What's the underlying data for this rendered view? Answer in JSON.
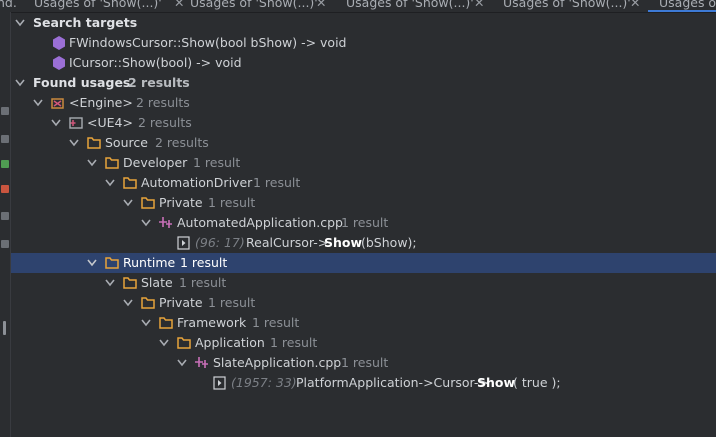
{
  "tabs": [
    {
      "label": "nd."
    },
    {
      "label": "Usages of 'Show(...)'"
    },
    {
      "label": "Usages of 'Show(...)'"
    },
    {
      "label": "Usages of 'Show(...)'"
    },
    {
      "label": "Usages of 'Show(...)'"
    },
    {
      "label": "Usages of"
    }
  ],
  "search_targets": {
    "label": "Search targets",
    "items": [
      "FWindowsCursor::Show(bool bShow) -> void",
      "ICursor::Show(bool) -> void"
    ]
  },
  "found_usages": {
    "label": "Found usages",
    "count": "2 results",
    "engine": {
      "name": "<Engine>",
      "count": "2 results"
    },
    "ue4": {
      "name": "<UE4>",
      "count": "2 results"
    },
    "source": {
      "name": "Source",
      "count": "2 results"
    },
    "developer": {
      "name": "Developer",
      "count": "1 result"
    },
    "automation_driver": {
      "name": "AutomationDriver",
      "count": "1 result"
    },
    "private1": {
      "name": "Private",
      "count": "1 result"
    },
    "automated_app_cpp": {
      "name": "AutomatedApplication.cpp",
      "count": "1 result"
    },
    "usage1": {
      "loc": "(96: 17)",
      "pre": "RealCursor->",
      "kw": "Show",
      "post": "(bShow);"
    },
    "runtime": {
      "name": "Runtime",
      "count": "1 result"
    },
    "slate": {
      "name": "Slate",
      "count": "1 result"
    },
    "private2": {
      "name": "Private",
      "count": "1 result"
    },
    "framework": {
      "name": "Framework",
      "count": "1 result"
    },
    "application": {
      "name": "Application",
      "count": "1 result"
    },
    "slate_app_cpp": {
      "name": "SlateApplication.cpp",
      "count": "1 result"
    },
    "usage2": {
      "loc": "(1957: 33)",
      "pre": "PlatformApplication->Cursor->",
      "kw": "Show",
      "post": "( true );"
    }
  },
  "colors": {
    "background": "#2b2d30",
    "selection": "#2e436e",
    "folder": "#e8a33a",
    "method_icon": "#9b6fd6",
    "cpp_icon": "#c86fb7",
    "accent": "#3d7ad6"
  }
}
